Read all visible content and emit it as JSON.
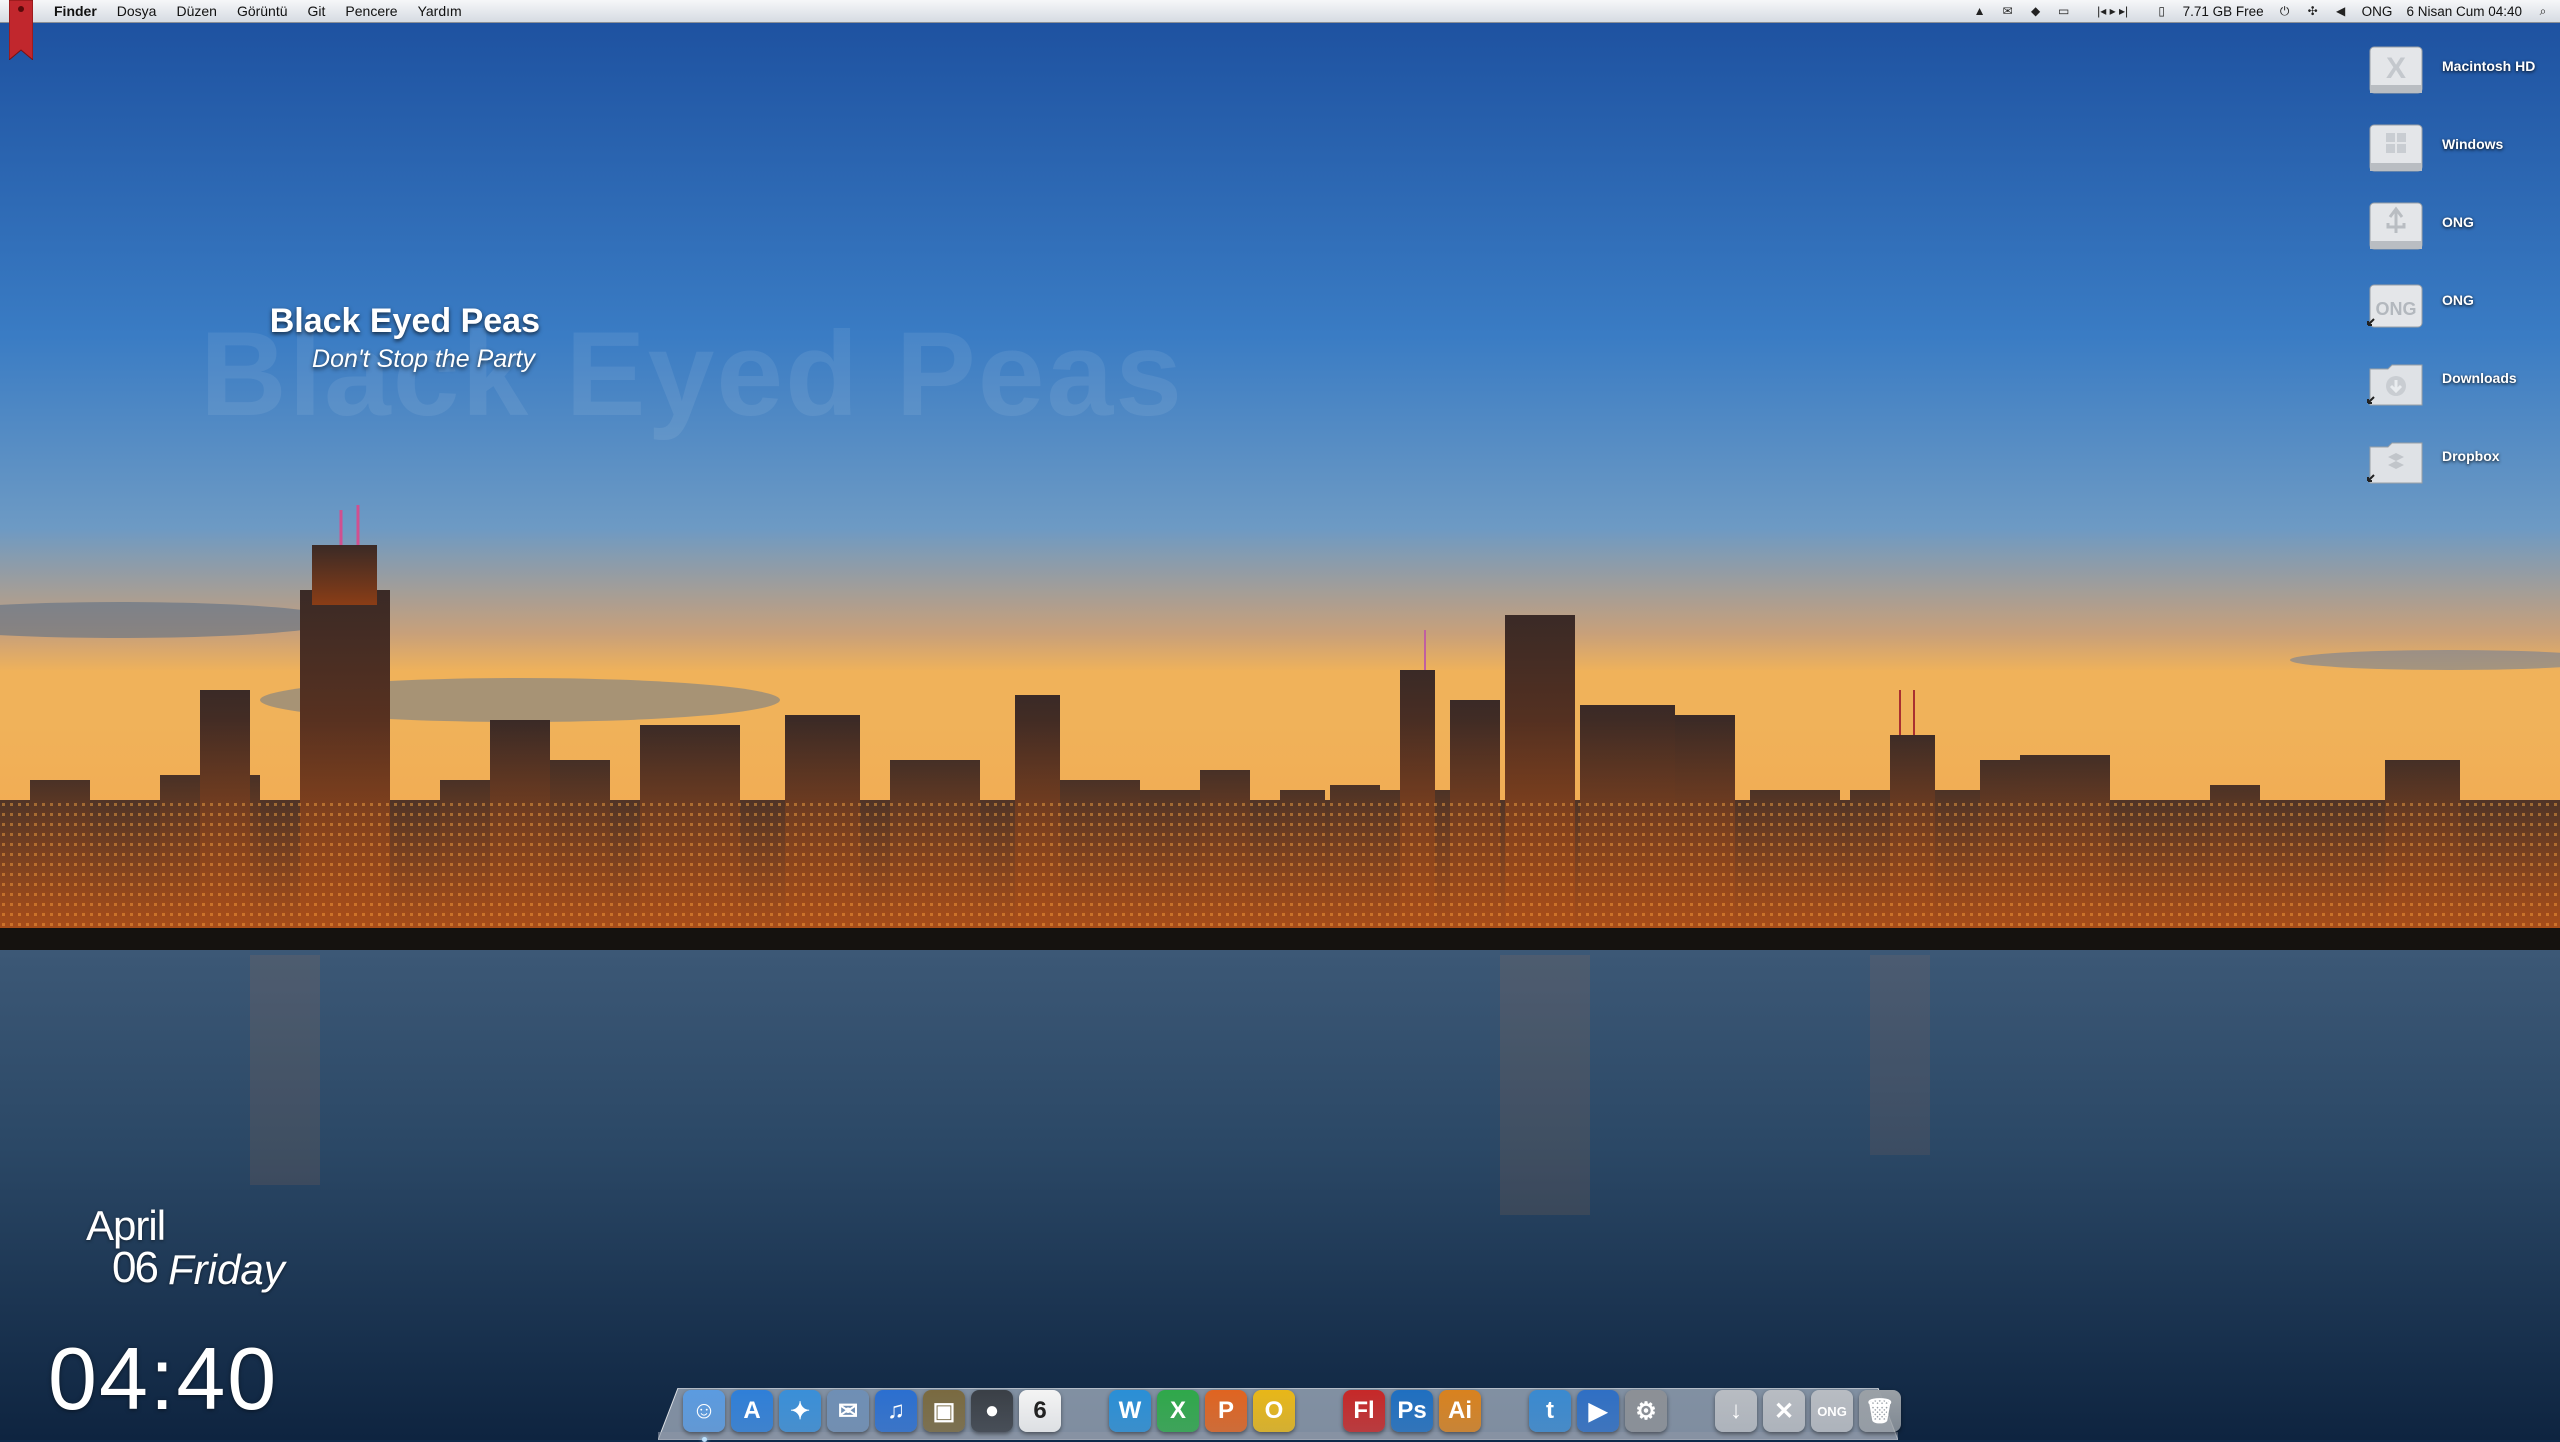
{
  "menubar": {
    "app": "Finder",
    "menus": [
      "Dosya",
      "Düzen",
      "Görüntü",
      "Git",
      "Pencere",
      "Yardım"
    ],
    "status": {
      "disk_free": "7.71 GB Free",
      "user": "ONG",
      "datetime": "6 Nisan Cum  04:40"
    },
    "status_icons": [
      "hat-icon",
      "mail-icon",
      "dropbox-icon",
      "display-icon",
      "media-controls-icon",
      "disk-icon",
      "power-icon",
      "bluetooth-icon",
      "volume-icon",
      "spotlight-icon"
    ]
  },
  "now_playing": {
    "artist": "Black Eyed Peas",
    "track": "Don't Stop the Party",
    "ghost": "Black Eyed Peas"
  },
  "desktop": {
    "icons": [
      {
        "label": "Macintosh HD",
        "icon": "hard-drive-x-icon"
      },
      {
        "label": "Windows",
        "icon": "hard-drive-windows-icon"
      },
      {
        "label": "ONG",
        "icon": "usb-drive-icon"
      },
      {
        "label": "ONG",
        "icon": "ong-folder-alias-icon"
      },
      {
        "label": "Downloads",
        "icon": "downloads-folder-alias-icon"
      },
      {
        "label": "Dropbox",
        "icon": "dropbox-folder-alias-icon"
      }
    ]
  },
  "clock": {
    "month": "April",
    "day": "06",
    "weekday": "Friday",
    "time": "04:40"
  },
  "dock": {
    "items": [
      {
        "name": "finder-icon",
        "glyph": "☺",
        "color": "#5b9be0",
        "running": true
      },
      {
        "name": "app-store-icon",
        "glyph": "A",
        "color": "#2f7fd8",
        "running": false
      },
      {
        "name": "safari-icon",
        "glyph": "✦",
        "color": "#3a8fd8",
        "running": false
      },
      {
        "name": "mail-stamp-icon",
        "glyph": "✉",
        "color": "#6f8fb5",
        "running": false
      },
      {
        "name": "itunes-icon",
        "glyph": "♫",
        "color": "#2b6fd0",
        "running": false
      },
      {
        "name": "iphoto-icon",
        "glyph": "▣",
        "color": "#7a6a40",
        "running": false
      },
      {
        "name": "facetime-icon",
        "glyph": "●",
        "color": "#3a3f46",
        "running": false
      },
      {
        "name": "ical-icon",
        "glyph": "6",
        "color": "#f4f4f4",
        "running": false
      },
      {
        "name": "gap-1",
        "glyph": "",
        "color": "",
        "running": false
      },
      {
        "name": "word-icon",
        "glyph": "W",
        "color": "#2a8fd6",
        "running": false
      },
      {
        "name": "excel-icon",
        "glyph": "X",
        "color": "#2fa84a",
        "running": false
      },
      {
        "name": "powerpoint-icon",
        "glyph": "P",
        "color": "#e06420",
        "running": false
      },
      {
        "name": "outlook-icon",
        "glyph": "O",
        "color": "#e8b718",
        "running": false
      },
      {
        "name": "gap-2",
        "glyph": "",
        "color": "",
        "running": false
      },
      {
        "name": "flash-icon",
        "glyph": "Fl",
        "color": "#c62828",
        "running": false
      },
      {
        "name": "photoshop-icon",
        "glyph": "Ps",
        "color": "#1f6fc0",
        "running": false
      },
      {
        "name": "illustrator-icon",
        "glyph": "Ai",
        "color": "#d9821e",
        "running": false
      },
      {
        "name": "gap-3",
        "glyph": "",
        "color": "",
        "running": false
      },
      {
        "name": "twitter-icon",
        "glyph": "t",
        "color": "#3a8ad0",
        "running": false
      },
      {
        "name": "quicktime-icon",
        "glyph": "▶",
        "color": "#2f6fc4",
        "running": false
      },
      {
        "name": "system-preferences-icon",
        "glyph": "⚙",
        "color": "#8c9096",
        "running": false
      },
      {
        "name": "gap-4",
        "glyph": "",
        "color": "",
        "running": false
      },
      {
        "name": "downloads-stack-icon",
        "glyph": "↓",
        "color": "#b8bcc2",
        "running": false
      },
      {
        "name": "applications-stack-icon",
        "glyph": "✕",
        "color": "#b8bcc2",
        "running": false
      },
      {
        "name": "ong-stack-icon",
        "glyph": "ONG",
        "color": "#b8bcc2",
        "running": false
      },
      {
        "name": "trash-icon",
        "glyph": "🗑",
        "color": "#9aa0a6",
        "running": false
      }
    ]
  }
}
